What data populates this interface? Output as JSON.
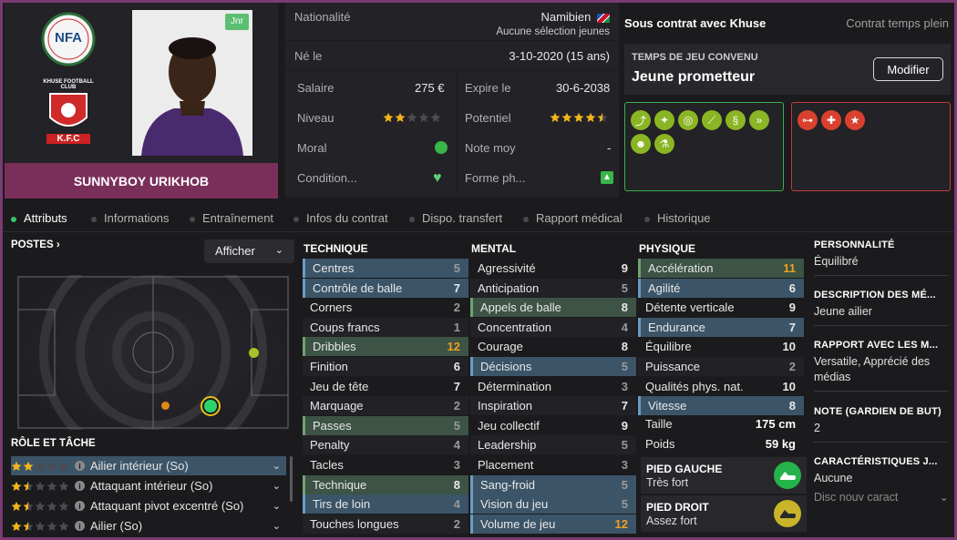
{
  "player": {
    "name": "SUNNYBOY URIKHOB",
    "badge": "Jnr",
    "league_logo_text": "NFA",
    "club_logo_text": "K.F.C",
    "club_logo_top": "KHUSE FOOTBALL CLUB"
  },
  "info": {
    "nationality_label": "Nationalité",
    "nationality_value": "Namibien",
    "selection_value": "Aucune sélection jeunes",
    "born_label": "Né le",
    "born_value": "3-10-2020 (15 ans)",
    "salary_label": "Salaire",
    "salary_value": "275 €",
    "expire_label": "Expire le",
    "expire_value": "30-6-2038",
    "level_label": "Niveau",
    "level_stars": 2,
    "potential_label": "Potentiel",
    "potential_stars": 4.5,
    "morale_label": "Moral",
    "avg_label": "Note moy",
    "avg_value": "-",
    "condition_label": "Condition...",
    "form_label": "Forme ph..."
  },
  "contract": {
    "title": "Sous contrat avec Khuse",
    "type": "Contrat temps plein",
    "playtime_label": "TEMPS DE JEU CONVENU",
    "playtime_value": "Jeune prometteur",
    "modify_button": "Modifier"
  },
  "traits": {
    "good_icons": [
      "run-icon",
      "brain-icon",
      "target-icon",
      "pen-icon",
      "curve-icon",
      "dribble-icon",
      "head-icon",
      "flask-icon"
    ],
    "bad_icons": [
      "dumbbell-icon",
      "injury-icon",
      "star-icon"
    ]
  },
  "tabs": [
    "Attributs",
    "Informations",
    "Entraînement",
    "Infos du contrat",
    "Dispo. transfert",
    "Rapport médical",
    "Historique"
  ],
  "positions": {
    "title": "POSTES",
    "show_button": "Afficher"
  },
  "roles": {
    "title": "RÔLE ET TÂCHE",
    "items": [
      {
        "label": "Ailier intérieur (So)",
        "stars": 2
      },
      {
        "label": "Attaquant intérieur (So)",
        "stars": 1.5
      },
      {
        "label": "Attaquant pivot excentré (So)",
        "stars": 1.5
      },
      {
        "label": "Ailier (So)",
        "stars": 1.5
      }
    ]
  },
  "technique": {
    "title": "TECHNIQUE",
    "items": [
      {
        "name": "Centres",
        "value": "5",
        "hl": "blue"
      },
      {
        "name": "Contrôle de balle",
        "value": "7",
        "hl": "blue"
      },
      {
        "name": "Corners",
        "value": "2",
        "hl": ""
      },
      {
        "name": "Coups francs",
        "value": "1",
        "hl": ""
      },
      {
        "name": "Dribbles",
        "value": "12",
        "hl": "green"
      },
      {
        "name": "Finition",
        "value": "6",
        "hl": ""
      },
      {
        "name": "Jeu de tête",
        "value": "7",
        "hl": ""
      },
      {
        "name": "Marquage",
        "value": "2",
        "hl": ""
      },
      {
        "name": "Passes",
        "value": "5",
        "hl": "green"
      },
      {
        "name": "Penalty",
        "value": "4",
        "hl": ""
      },
      {
        "name": "Tacles",
        "value": "3",
        "hl": ""
      },
      {
        "name": "Technique",
        "value": "8",
        "hl": "green"
      },
      {
        "name": "Tirs de loin",
        "value": "4",
        "hl": "blue"
      },
      {
        "name": "Touches longues",
        "value": "2",
        "hl": ""
      }
    ]
  },
  "mental": {
    "title": "MENTAL",
    "items": [
      {
        "name": "Agressivité",
        "value": "9",
        "hl": ""
      },
      {
        "name": "Anticipation",
        "value": "5",
        "hl": ""
      },
      {
        "name": "Appels de balle",
        "value": "8",
        "hl": "green"
      },
      {
        "name": "Concentration",
        "value": "4",
        "hl": ""
      },
      {
        "name": "Courage",
        "value": "8",
        "hl": ""
      },
      {
        "name": "Décisions",
        "value": "5",
        "hl": "blue"
      },
      {
        "name": "Détermination",
        "value": "3",
        "hl": ""
      },
      {
        "name": "Inspiration",
        "value": "7",
        "hl": ""
      },
      {
        "name": "Jeu collectif",
        "value": "9",
        "hl": ""
      },
      {
        "name": "Leadership",
        "value": "5",
        "hl": ""
      },
      {
        "name": "Placement",
        "value": "3",
        "hl": ""
      },
      {
        "name": "Sang-froid",
        "value": "5",
        "hl": "blue"
      },
      {
        "name": "Vision du jeu",
        "value": "5",
        "hl": "blue"
      },
      {
        "name": "Volume de jeu",
        "value": "12",
        "hl": "blue"
      }
    ]
  },
  "physique": {
    "title": "PHYSIQUE",
    "items": [
      {
        "name": "Accélération",
        "value": "11",
        "hl": "green"
      },
      {
        "name": "Agilité",
        "value": "6",
        "hl": "blue"
      },
      {
        "name": "Détente verticale",
        "value": "9",
        "hl": ""
      },
      {
        "name": "Endurance",
        "value": "7",
        "hl": "blue"
      },
      {
        "name": "Équilibre",
        "value": "10",
        "hl": ""
      },
      {
        "name": "Puissance",
        "value": "2",
        "hl": ""
      },
      {
        "name": "Qualités phys. nat.",
        "value": "10",
        "hl": ""
      },
      {
        "name": "Vitesse",
        "value": "8",
        "hl": "blue"
      }
    ],
    "height_label": "Taille",
    "height_value": "175 cm",
    "weight_label": "Poids",
    "weight_value": "59 kg",
    "left_foot_label": "PIED GAUCHE",
    "left_foot_value": "Très fort",
    "right_foot_label": "PIED DROIT",
    "right_foot_value": "Assez fort"
  },
  "personality": {
    "p_title": "PERSONNALITÉ",
    "p_value": "Équilibré",
    "desc_title": "DESCRIPTION DES MÉ...",
    "desc_value": "Jeune ailier",
    "media_title": "RAPPORT AVEC LES M...",
    "media_value": "Versatile, Apprécié des médias",
    "gk_title": "NOTE (GARDIEN DE BUT)",
    "gk_value": "2",
    "char_title": "CARACTÉRISTIQUES J...",
    "char_value": "Aucune",
    "char_sub": "Disc nouv caract"
  },
  "colors": {
    "value_normal": "#9a9a9a",
    "value_high": "#e8e8e8",
    "value_top": "#f0a020",
    "star": "#f2b51b",
    "good_trait": "#8ab524",
    "bad_trait": "#d9412e",
    "club_panel": "#7a2f5a"
  }
}
